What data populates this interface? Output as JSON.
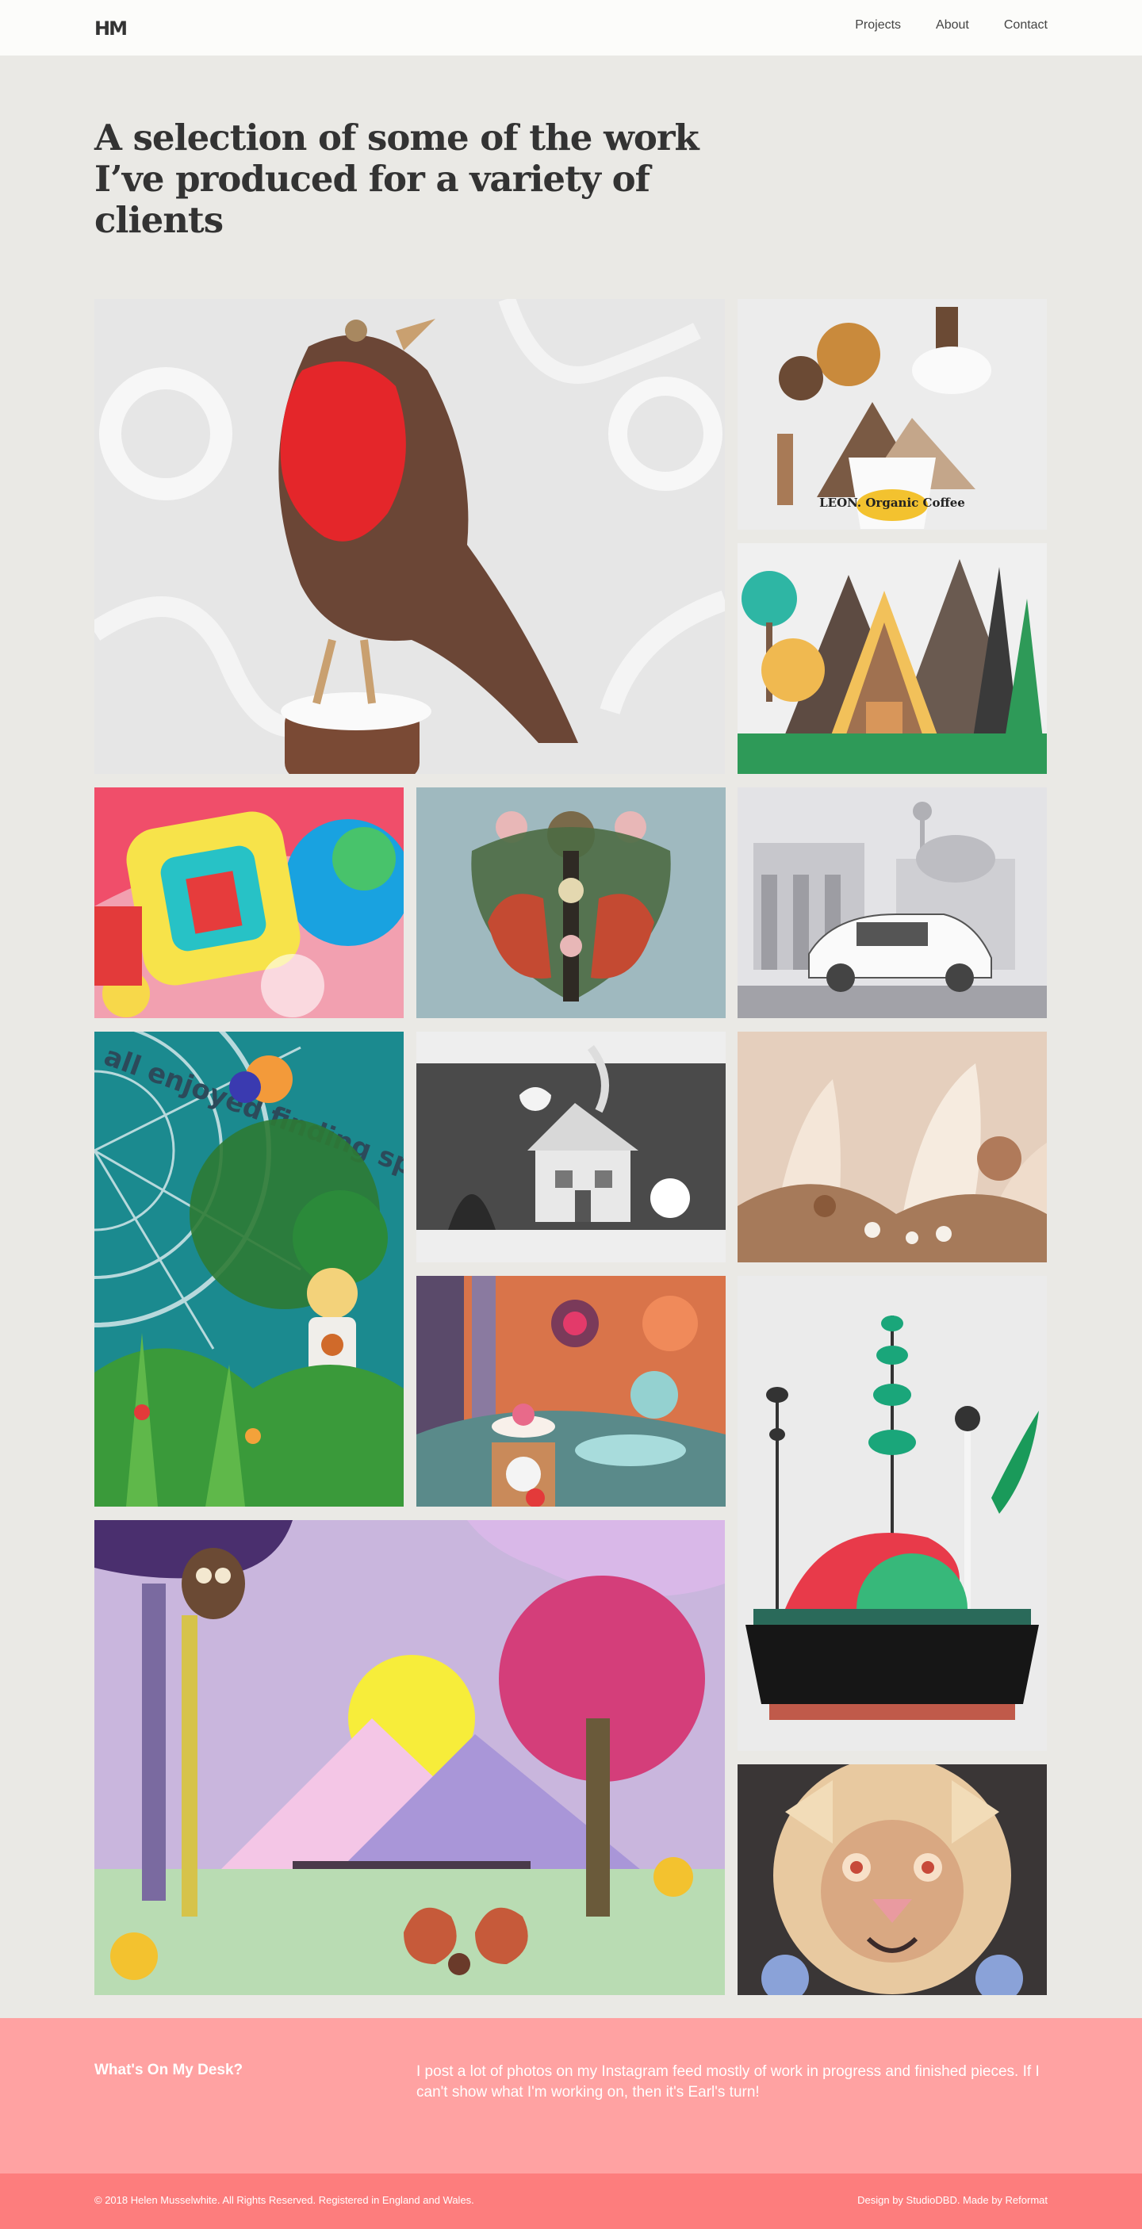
{
  "header": {
    "logo": "HM",
    "nav": [
      "Projects",
      "About",
      "Contact"
    ]
  },
  "intro": "A selection of some of the work I’ve produced for a variety of clients",
  "gallery": {
    "items": [
      {
        "name": "robin",
        "alt": "Paper robin on white papercut backdrop"
      },
      {
        "name": "leon-coffee",
        "label": "LEON. Organic Coffee"
      },
      {
        "name": "a-frame-cabin"
      },
      {
        "name": "colourful-abstract"
      },
      {
        "name": "symmetrical-foxes"
      },
      {
        "name": "audi-berlin"
      },
      {
        "name": "spider-web",
        "label": "all enjoyed finding spid"
      },
      {
        "name": "night-cottage"
      },
      {
        "name": "paper-forest"
      },
      {
        "name": "tea-party"
      },
      {
        "name": "bonsai-planter"
      },
      {
        "name": "woodland-scene"
      },
      {
        "name": "lion"
      }
    ]
  },
  "desk": {
    "title": "What's On My Desk?",
    "text": "I post a lot of photos on my Instagram feed mostly of work in progress and finished pieces. If I can't show what I'm working on, then it's Earl's turn!"
  },
  "footer": {
    "copyright": "© 2018 Helen Musselwhite. All Rights Reserved. Registered in England and Wales.",
    "credits": "Design by StudioDBD. Made by Reformat"
  }
}
